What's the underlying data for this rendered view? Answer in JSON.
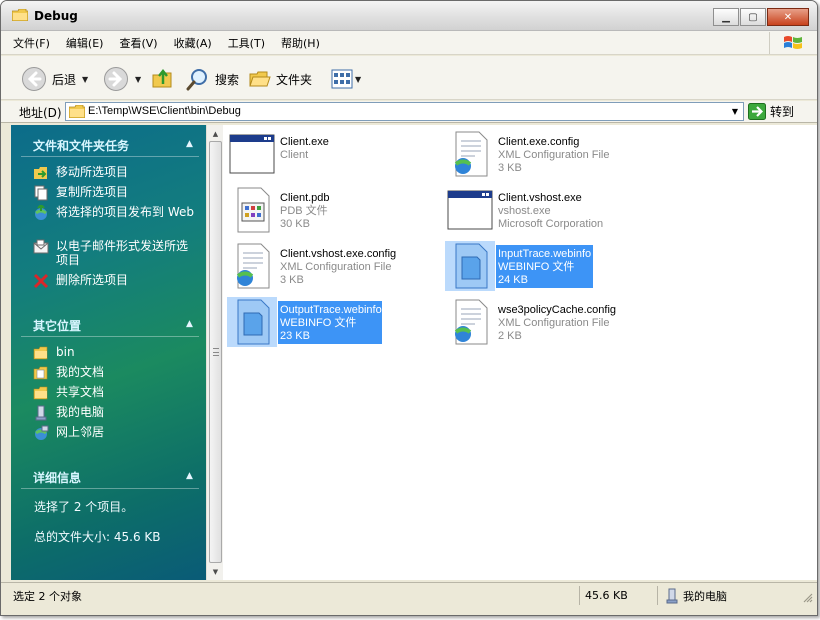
{
  "window": {
    "title": "Debug"
  },
  "menu": [
    "文件(F)",
    "编辑(E)",
    "查看(V)",
    "收藏(A)",
    "工具(T)",
    "帮助(H)"
  ],
  "toolbar": {
    "back": "后退",
    "search": "搜索",
    "folders": "文件夹"
  },
  "address": {
    "label": "地址(D)",
    "path": "E:\\Temp\\WSE\\Client\\bin\\Debug",
    "go": "转到"
  },
  "taskpane": {
    "section1": {
      "title": "文件和文件夹任务",
      "items": [
        "移动所选项目",
        "复制所选项目",
        "将选择的项目发布到 Web",
        "以电子邮件形式发送所选项目",
        "删除所选项目"
      ]
    },
    "section2": {
      "title": "其它位置",
      "items": [
        "bin",
        "我的文档",
        "共享文档",
        "我的电脑",
        "网上邻居"
      ]
    },
    "section3": {
      "title": "详细信息",
      "line1": "选择了 2 个项目。",
      "line2": "总的文件大小: 45.6 KB"
    }
  },
  "files": [
    {
      "name": "Client.exe",
      "type": "Client",
      "size": "",
      "icon": "exe-window-icon",
      "selected": false
    },
    {
      "name": "Client.exe.config",
      "type": "XML Configuration File",
      "size": "3 KB",
      "icon": "xml-config-icon",
      "selected": false
    },
    {
      "name": "Client.pdb",
      "type": "PDB 文件",
      "size": "30 KB",
      "icon": "pdb-file-icon",
      "selected": false
    },
    {
      "name": "Client.vshost.exe",
      "type": "vshost.exe",
      "size": "Microsoft Corporation",
      "icon": "exe-window-icon",
      "selected": false
    },
    {
      "name": "Client.vshost.exe.config",
      "type": "XML Configuration File",
      "size": "3 KB",
      "icon": "xml-config-icon",
      "selected": false
    },
    {
      "name": "InputTrace.webinfo",
      "type": "WEBINFO 文件",
      "size": "24 KB",
      "icon": "webinfo-file-icon",
      "selected": true
    },
    {
      "name": "OutputTrace.webinfo",
      "type": "WEBINFO 文件",
      "size": "23 KB",
      "icon": "webinfo-file-icon",
      "selected": true
    },
    {
      "name": "wse3policyCache.config",
      "type": "XML Configuration File",
      "size": "2 KB",
      "icon": "xml-config-icon",
      "selected": false
    }
  ],
  "status": {
    "left": "选定 2 个对象",
    "size": "45.6 KB",
    "location": "我的电脑"
  }
}
